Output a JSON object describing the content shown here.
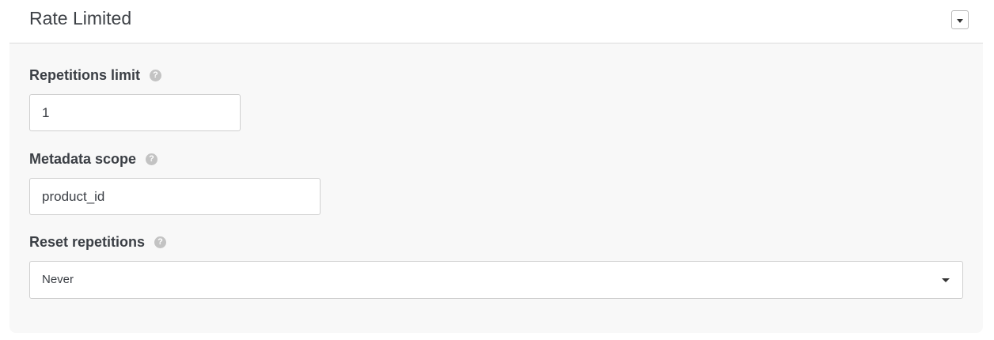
{
  "panel": {
    "title": "Rate Limited",
    "collapse_icon": "caret-down-icon"
  },
  "fields": {
    "repetitions_limit": {
      "label": "Repetitions limit",
      "help_icon": "question-circle-icon",
      "value": "1"
    },
    "metadata_scope": {
      "label": "Metadata scope",
      "help_icon": "question-circle-icon",
      "value": "product_id"
    },
    "reset_repetitions": {
      "label": "Reset repetitions",
      "help_icon": "question-circle-icon",
      "selected": "Never"
    }
  }
}
